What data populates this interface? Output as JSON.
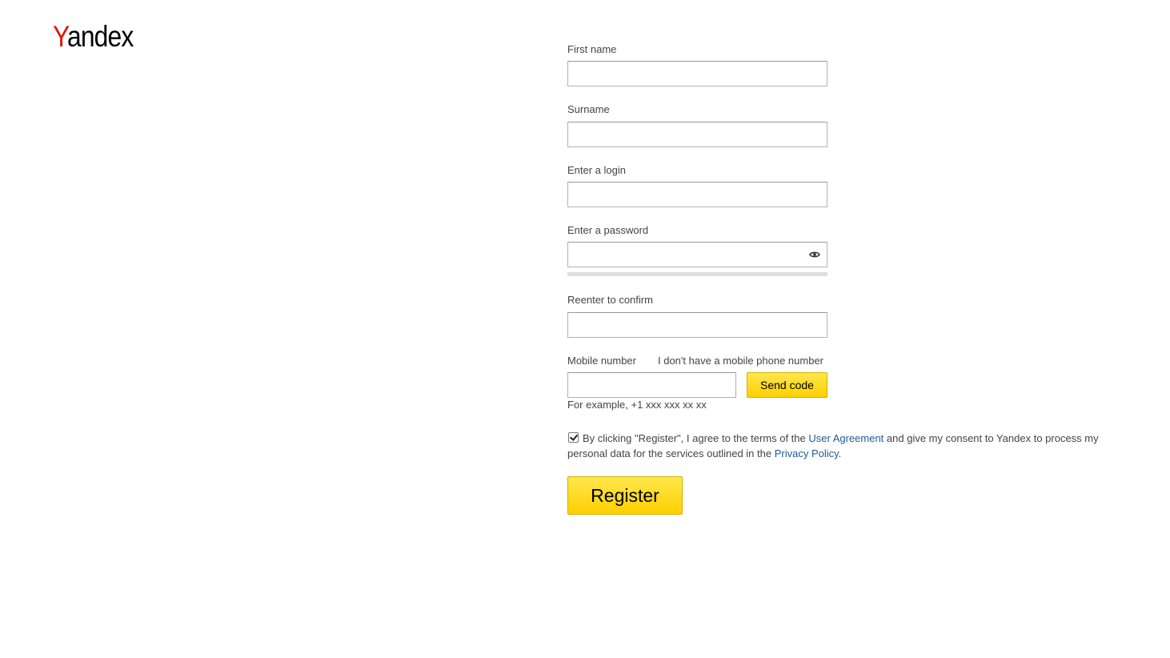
{
  "brand": {
    "logo_first": "Y",
    "logo_rest": "andex"
  },
  "form": {
    "first_name": {
      "label": "First name",
      "value": ""
    },
    "surname": {
      "label": "Surname",
      "value": ""
    },
    "login": {
      "label": "Enter a login",
      "value": ""
    },
    "password": {
      "label": "Enter a password",
      "value": "",
      "icon": "eye-icon"
    },
    "confirm": {
      "label": "Reenter to confirm",
      "value": ""
    },
    "mobile": {
      "label": "Mobile number",
      "no_phone_link": "I don't have a mobile phone number",
      "value": "",
      "send_code_label": "Send code",
      "hint": "For example, +1 xxx xxx xx xx"
    },
    "consent": {
      "checked": true,
      "text_1": "By clicking \"Register\", I agree to the terms of the ",
      "link_1": "User Agreement",
      "text_2": " and give my consent to Yandex to process my personal data for the services outlined in the ",
      "link_2": "Privacy Policy",
      "text_3": "."
    },
    "register_label": "Register"
  },
  "colors": {
    "brand_red": "#e61400",
    "button_yellow": "#ffdb4d",
    "link_blue": "#1f5a9a"
  }
}
